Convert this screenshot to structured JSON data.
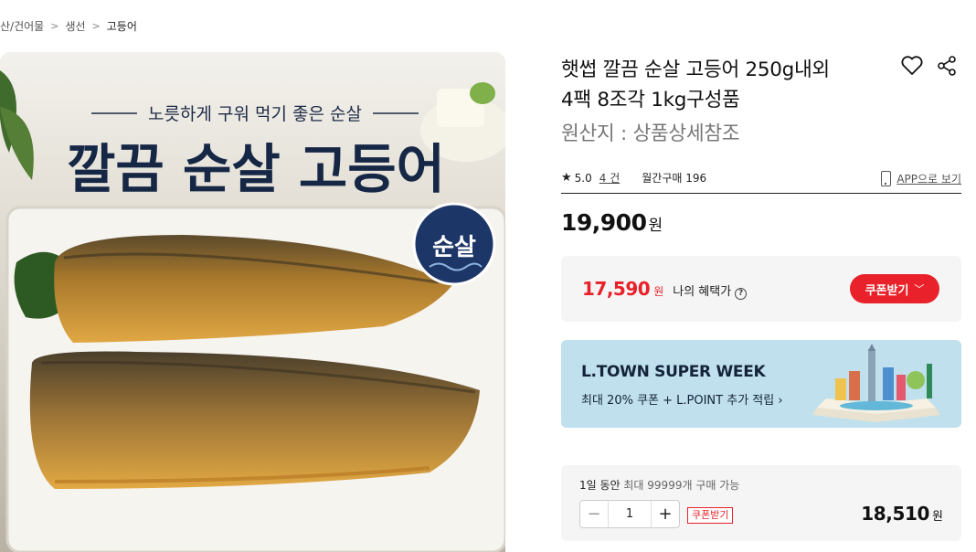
{
  "breadcrumb": [
    "산/건어물",
    "생선",
    "고등어"
  ],
  "product": {
    "title_line1": "햇썹 깔끔 순살 고등어 250g내외",
    "title_line2": "4팩 8조각 1kg구성품",
    "origin": "원산지 : 상품상세참조",
    "image_text": {
      "subtitle": "노릇하게 구워 먹기 좋은 순살",
      "headline": "깔끔 순살 고등어",
      "badge": "순살"
    }
  },
  "rating": {
    "star": "★",
    "score": "5.0",
    "review_count": "4 건",
    "monthly_sales": "월간구매 196",
    "app_link": "APP으로 보기"
  },
  "price": {
    "amount": "19,900",
    "unit": "원"
  },
  "benefit": {
    "amount": "17,590",
    "unit": "원",
    "label": "나의 혜택가",
    "help_icon": "?",
    "coupon_button": "쿠폰받기",
    "coupon_chevron": "﹀"
  },
  "banner": {
    "title": "L.TOWN SUPER WEEK",
    "subtitle": "최대 20% 쿠폰 + L.POINT 추가 적립 ›"
  },
  "order": {
    "limit_prefix": "1일 동안",
    "limit_text": " 최대 99999개 구매 가능",
    "minus": "−",
    "quantity": "1",
    "plus": "+",
    "coupon_tag": "쿠폰받기",
    "total": "18,510",
    "total_unit": "원"
  },
  "colors": {
    "accent": "#e8212a",
    "banner_bg": "#bfe0ec",
    "box_bg": "#f5f5f5"
  },
  "icons": [
    "heart-icon",
    "share-icon",
    "star-icon",
    "phone-icon",
    "help-icon",
    "chevron-down-icon"
  ]
}
